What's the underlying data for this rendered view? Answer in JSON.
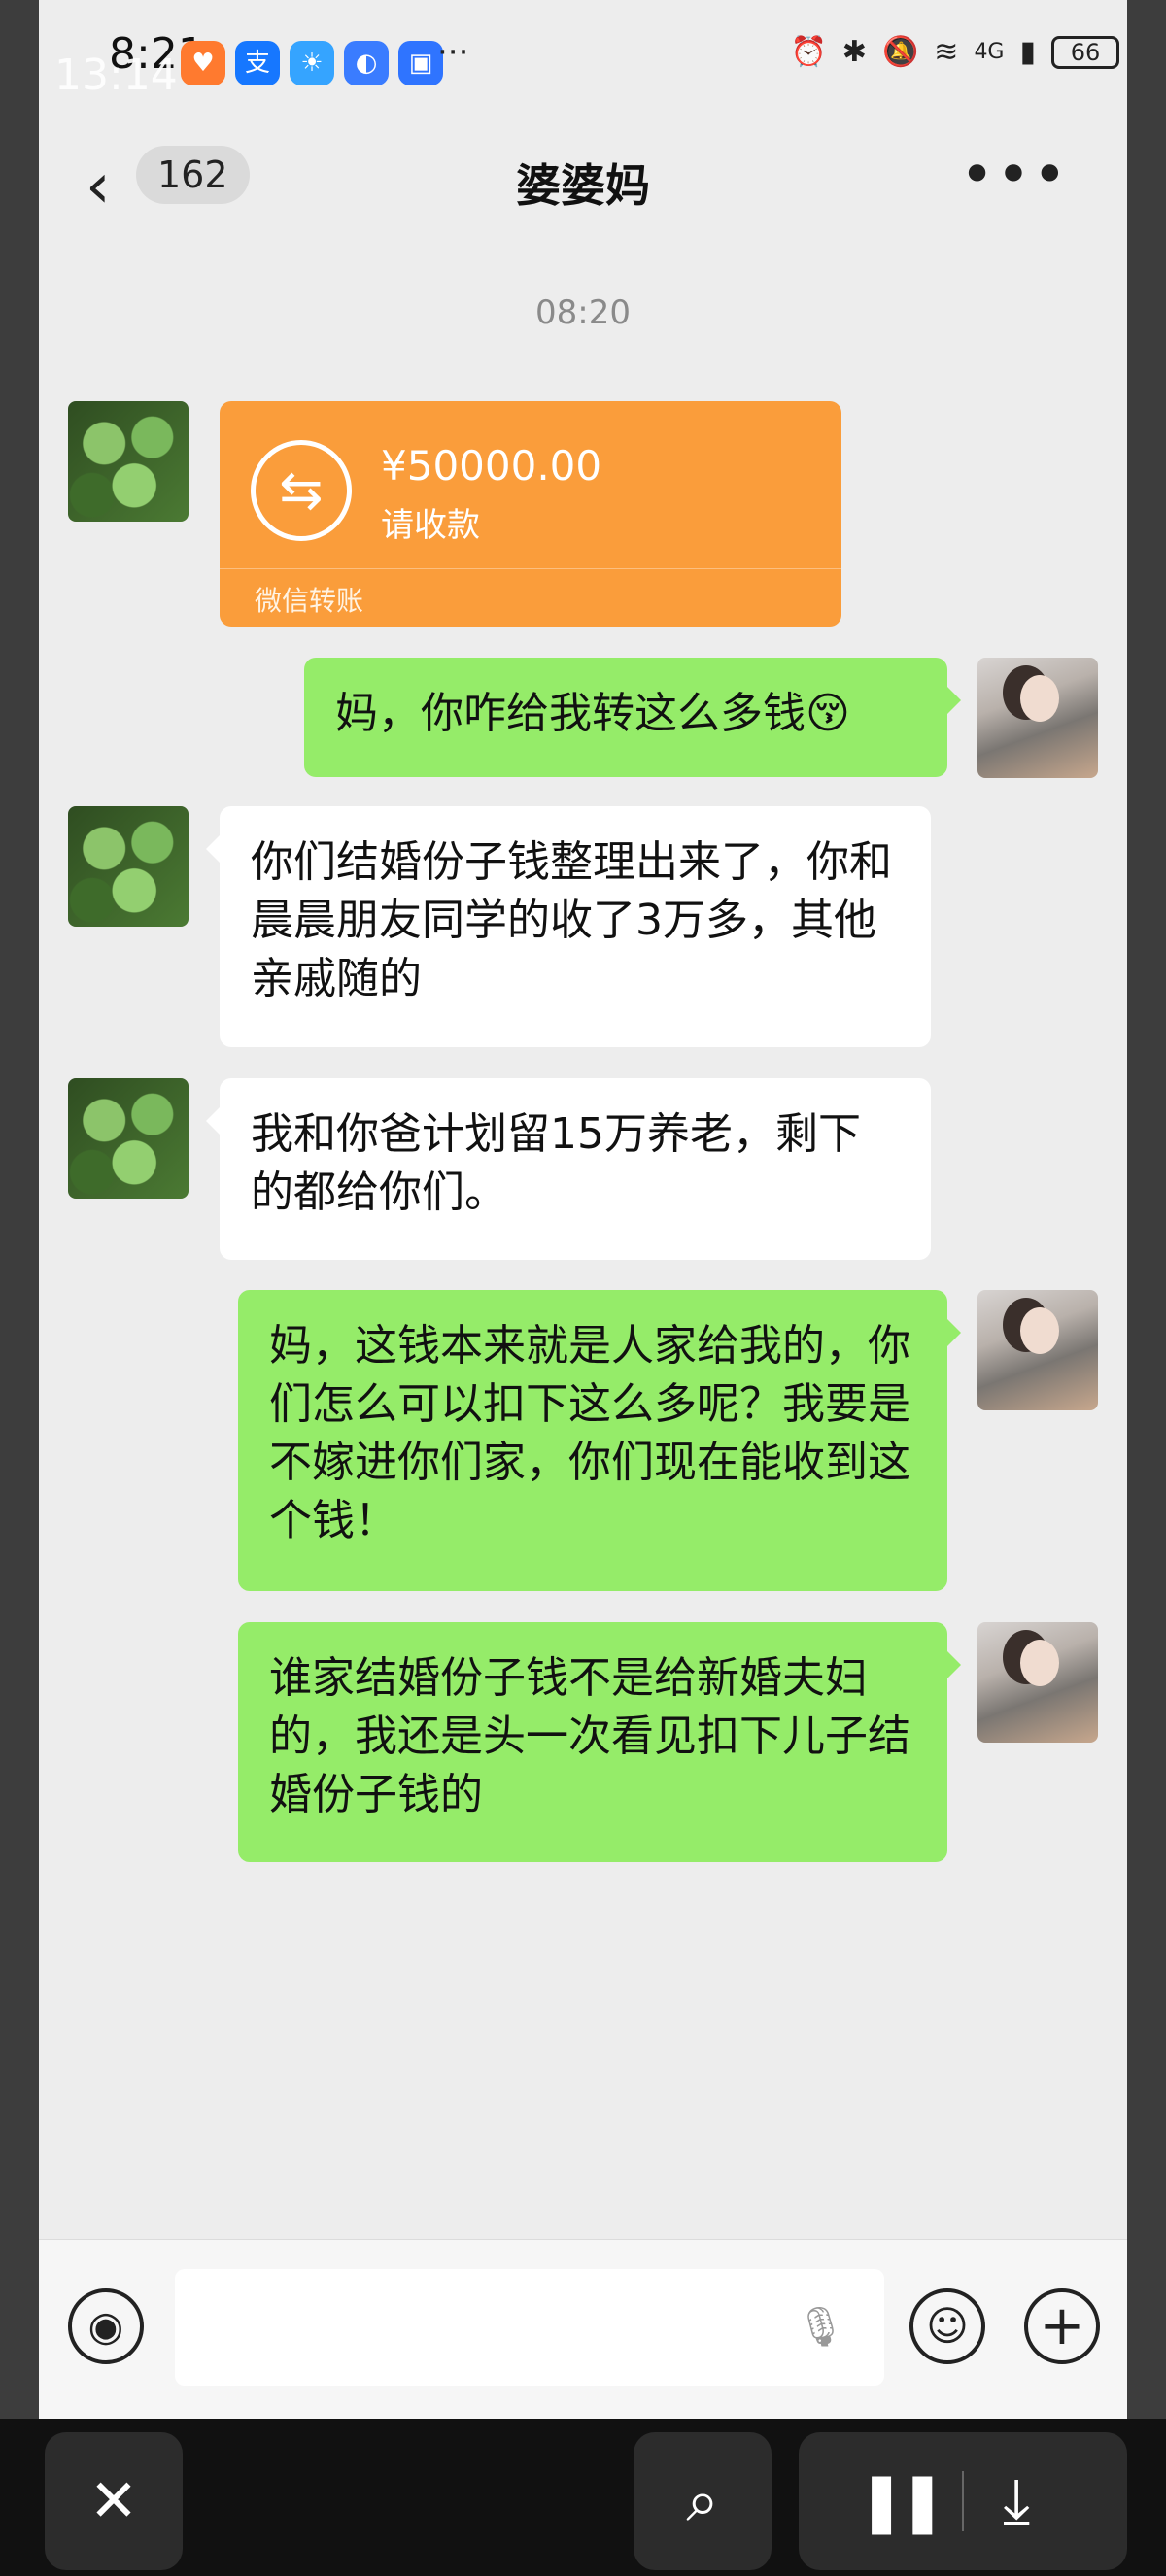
{
  "status": {
    "time_back": "8:21",
    "time_front": "13:14",
    "overflow": "···",
    "battery": "66",
    "network": "4G",
    "app_icons": [
      {
        "name": "heart-app-icon",
        "glyph": "♥",
        "color": "#ff7a2f"
      },
      {
        "name": "alipay-app-icon",
        "glyph": "支",
        "color": "#1677ff"
      },
      {
        "name": "weather-app-icon",
        "glyph": "☀",
        "color": "#35a4ff"
      },
      {
        "name": "browser-app-icon",
        "glyph": "◐",
        "color": "#3a7cff"
      },
      {
        "name": "clipboard-app-icon",
        "glyph": "▣",
        "color": "#2f74ff"
      }
    ]
  },
  "header": {
    "back_count": "162",
    "title": "婆婆妈",
    "more": "•••"
  },
  "chat": {
    "timestamp": "08:20",
    "transfer": {
      "icon": "⇆",
      "amount": "¥50000.00",
      "subtitle": "请收款",
      "footer": "微信转账"
    },
    "messages": [
      {
        "side": "right",
        "text": "妈，你咋给我转这么多钱😚"
      },
      {
        "side": "left",
        "text": "你们结婚份子钱整理出来了，你和晨晨朋友同学的收了3万多，其他亲戚随的"
      },
      {
        "side": "left",
        "text": "我和你爸计划留15万养老，剩下的都给你们。"
      },
      {
        "side": "right",
        "text": "妈，这钱本来就是人家给我的，你们怎么可以扣下这么多呢？我要是不嫁进你们家，你们现在能收到这个钱！"
      },
      {
        "side": "right",
        "text": "谁家结婚份子钱不是给新婚夫妇的，我还是头一次看见扣下儿子结婚份子钱的"
      }
    ]
  },
  "input": {
    "voice_icon": "◉",
    "mic_icon": "🎙",
    "emoji_icon": "☺",
    "plus_icon": "+"
  },
  "recorder": {
    "close": "✕",
    "scan": "⌕",
    "pause": "❚❚",
    "download": "⤓"
  }
}
